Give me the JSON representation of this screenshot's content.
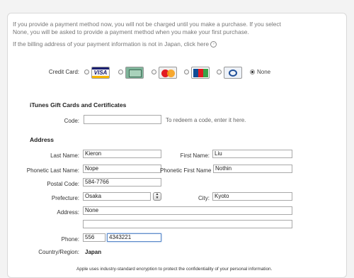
{
  "intro": {
    "line1": "If you provide a payment method now, you will not be charged until you make a purchase. If you select",
    "line2": "None, you will be asked to provide a payment method when you make your first purchase.",
    "billing_link": "If the billing address of your payment information is not in Japan, click here"
  },
  "payment": {
    "label": "Credit Card:",
    "cards": [
      "VISA",
      "American Express",
      "MasterCard",
      "JCB",
      "Diners Club"
    ],
    "none_label": "None",
    "selected": "None"
  },
  "gift": {
    "heading": "iTunes Gift Cards and Certificates",
    "code_label": "Code:",
    "code_value": "",
    "hint": "To redeem a code, enter it here."
  },
  "address": {
    "heading": "Address",
    "last_name_label": "Last Name:",
    "last_name": "Kieron",
    "first_name_label": "First Name:",
    "first_name": "Liu",
    "phonetic_last_label": "Phonetic Last Name:",
    "phonetic_last": "Nope",
    "phonetic_first_label": "Phonetic First Name",
    "phonetic_first": "Nothin",
    "postal_label": "Postal Code:",
    "postal": "584-7766",
    "prefecture_label": "Prefecture:",
    "prefecture": "Osaka",
    "city_label": "City:",
    "city": "Kyoto",
    "address_label": "Address:",
    "address1": "None",
    "address2": "",
    "phone_label": "Phone:",
    "phone_area": "556",
    "phone_number": "4343221",
    "country_label": "Country/Region:",
    "country": "Japan"
  },
  "footer": {
    "note": "Apple uses industry-standard encryption to protect the confidentiality of your personal information."
  }
}
